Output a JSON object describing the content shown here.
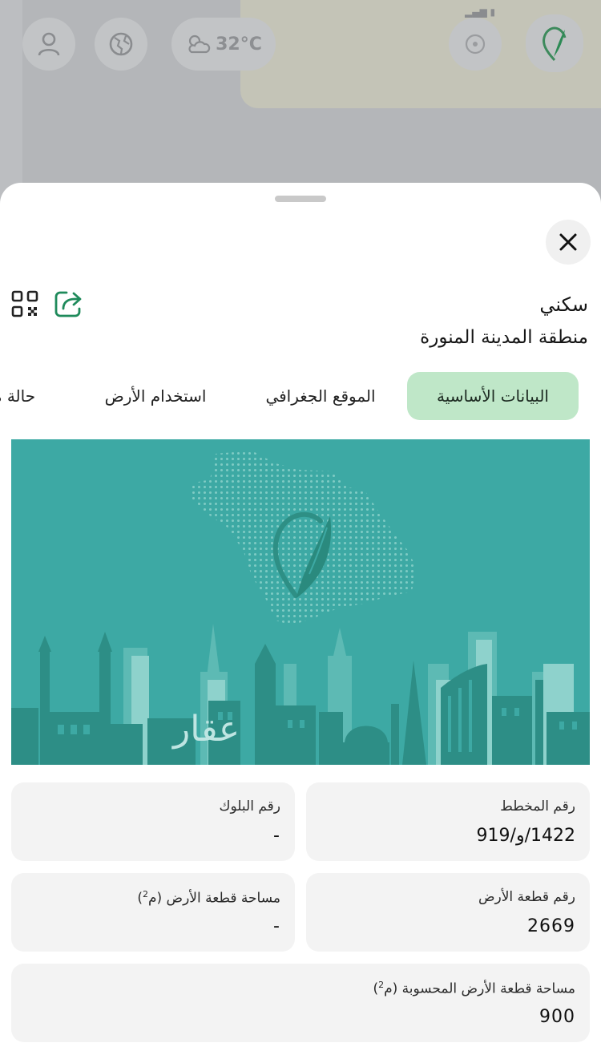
{
  "status_bar": {
    "signal": ""
  },
  "background_app": {
    "weather_temp": "32°C",
    "buttons": [
      "user-button",
      "globe-button",
      "weather-button",
      "location-button",
      "logo-button"
    ]
  },
  "sheet": {
    "title": "سكني",
    "subtitle": "منطقة المدينة المنورة",
    "tabs": [
      {
        "label": "البيانات الأساسية",
        "active": true
      },
      {
        "label": "الموقع الجغرافي",
        "active": false
      },
      {
        "label": "استخدام الأرض",
        "active": false
      },
      {
        "label": "حالة ة",
        "active": false
      }
    ],
    "banner_brand": "عقار",
    "fields": {
      "plan_number_label": "رقم المخطط",
      "plan_number_value": "1422/و/919",
      "block_number_label": "رقم البلوك",
      "block_number_value": "-",
      "plot_number_label": "رقم قطعة الأرض",
      "plot_number_value": "2669",
      "plot_area_label": "مساحة قطعة الأرض (م",
      "plot_area_value": "-",
      "calc_area_label": "مساحة قطعة الأرض المحسوبة (م",
      "calc_area_value": "900",
      "superscript": "2",
      "paren_close": ")"
    }
  },
  "colors": {
    "accent_green": "#1f8a5b",
    "active_tab_bg": "#bfe7c8",
    "banner_teal": "#3da9a4",
    "card_bg": "#f3f3f3"
  }
}
